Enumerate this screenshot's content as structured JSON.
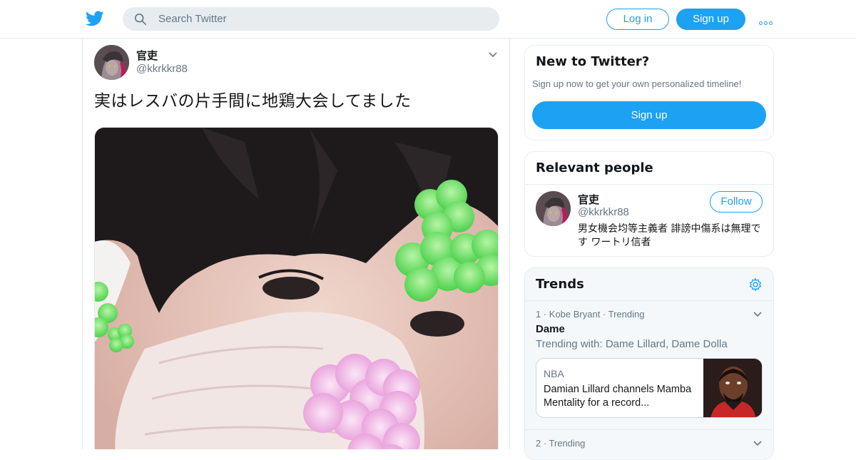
{
  "header": {
    "search_placeholder": "Search Twitter",
    "login_label": "Log in",
    "signup_label": "Sign up",
    "brand_color": "#1da1f2"
  },
  "tweet": {
    "author_name": "官吏",
    "author_handle": "@kkrkkr88",
    "text": "実はレスバの片手間に地鶏大会してました",
    "media_icon": "photo"
  },
  "sidebar": {
    "new_to_twitter": {
      "title": "New to Twitter?",
      "subtitle": "Sign up now to get your own personalized timeline!",
      "signup_label": "Sign up"
    },
    "relevant_people": {
      "title": "Relevant people",
      "person": {
        "name": "官吏",
        "handle": "@kkrkkr88",
        "bio": "男女機会均等主義者 誹謗中傷系は無理です ワートリ信者",
        "follow_label": "Follow"
      }
    },
    "trends": {
      "title": "Trends",
      "items": [
        {
          "meta": "1 · Kobe Bryant · Trending",
          "title": "Dame",
          "trending_with": "Trending with: Dame Lillard, Dame Dolla",
          "news": {
            "source": "NBA",
            "headline": "Damian Lillard channels Mamba Mentality for a record..."
          }
        },
        {
          "meta": "2 · Trending"
        }
      ]
    }
  }
}
